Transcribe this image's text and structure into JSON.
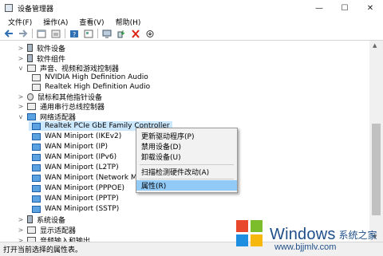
{
  "window": {
    "title": "设备管理器",
    "min": "—",
    "max": "☐",
    "close": "✕"
  },
  "menubar": {
    "items": [
      "文件(F)",
      "操作(A)",
      "查看(V)",
      "帮助(H)"
    ]
  },
  "toolbar": {
    "buttons": [
      "back-icon",
      "forward-icon",
      "properties-icon",
      "show-hidden-icon",
      "help-icon",
      "view-icon",
      "monitor-icon",
      "update-driver-icon",
      "uninstall-icon",
      "scan-icon"
    ]
  },
  "tree": {
    "rows": [
      {
        "label": "软件设备",
        "expanded": false,
        "child": false
      },
      {
        "label": "软件组件",
        "expanded": false,
        "child": false
      },
      {
        "label": "声音、视频和游戏控制器",
        "expanded": true,
        "child": false
      },
      {
        "label": "NVIDIA High Definition Audio",
        "child": true
      },
      {
        "label": "Realtek High Definition Audio",
        "child": true
      },
      {
        "label": "鼠标和其他指针设备",
        "expanded": false,
        "child": false
      },
      {
        "label": "通用串行总线控制器",
        "expanded": false,
        "child": false
      },
      {
        "label": "网络适配器",
        "expanded": true,
        "child": false
      },
      {
        "label": "Realtek PCIe GbE Family Controller",
        "child": true,
        "selected": true
      },
      {
        "label": "WAN Miniport (IKEv2)",
        "child": true
      },
      {
        "label": "WAN Miniport (IP)",
        "child": true
      },
      {
        "label": "WAN Miniport (IPv6)",
        "child": true
      },
      {
        "label": "WAN Miniport (L2TP)",
        "child": true
      },
      {
        "label": "WAN Miniport (Network Monitor)",
        "child": true
      },
      {
        "label": "WAN Miniport (PPPOE)",
        "child": true
      },
      {
        "label": "WAN Miniport (PPTP)",
        "child": true
      },
      {
        "label": "WAN Miniport (SSTP)",
        "child": true
      },
      {
        "label": "系统设备",
        "expanded": false,
        "child": false
      },
      {
        "label": "显示适配器",
        "expanded": false,
        "child": false
      },
      {
        "label": "音频输入和输出",
        "expanded": false,
        "child": false
      }
    ]
  },
  "context_menu": {
    "items": [
      "更新驱动程序(P)",
      "禁用设备(D)",
      "卸载设备(U)",
      "扫描检测硬件改动(A)",
      "属性(R)"
    ],
    "highlighted": "属性(R)"
  },
  "status": {
    "text": "打开当前选择的属性表。"
  },
  "watermark": {
    "brand": "Windows",
    "cn": "系统之家",
    "url": "www.bjjmlv.com"
  },
  "colors": {
    "selection": "#cce8ff",
    "menu_highlight": "#91c9f7",
    "watermark": "#1e4f8a"
  }
}
